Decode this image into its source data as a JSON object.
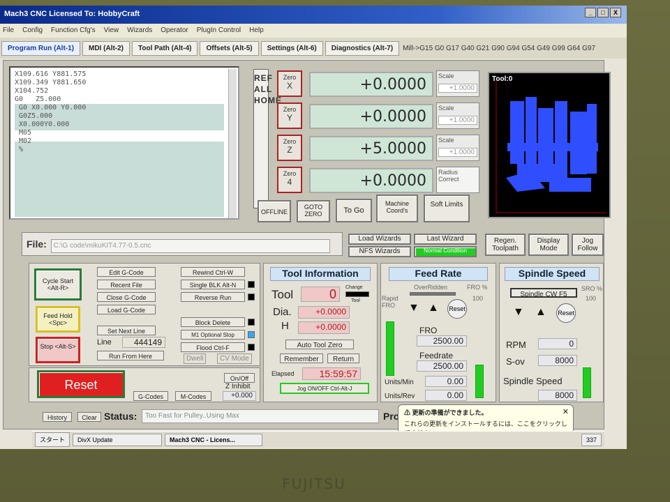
{
  "window": {
    "title": "Mach3 CNC   Licensed To: HobbyCraft",
    "buttons": [
      "_",
      "□",
      "X"
    ]
  },
  "menu": [
    "File",
    "Config",
    "Function Cfg's",
    "View",
    "Wizards",
    "Operator",
    "PlugIn Control",
    "Help"
  ],
  "tabs": [
    "Program Run (Alt-1)",
    "MDI (Alt-2)",
    "Tool Path (Alt-4)",
    "Offsets (Alt-5)",
    "Settings (Alt-6)",
    "Diagnostics (Alt-7)"
  ],
  "gcode_status": "Mill->G15  G0 G17 G40 G21 G90 G94 G54 G49 G99 G64 G97",
  "gcode_lines": [
    "X109.616 Y881.575",
    "X109.349 Y881.650",
    "X104.752",
    "G0   Z5.000",
    " G0 X0.000 Y0.000",
    " G0Z5.000",
    " X0.000Y0.000",
    " M05",
    " M02",
    " %"
  ],
  "refhome": "REF ALL HOME",
  "axes": [
    {
      "zero_label": "Zero",
      "axis": "X",
      "value": "+0.0000",
      "scale_label": "Scale",
      "scale": "+1.0000"
    },
    {
      "zero_label": "Zero",
      "axis": "Y",
      "value": "+0.0000",
      "scale_label": "Scale",
      "scale": "+1.0000"
    },
    {
      "zero_label": "Zero",
      "axis": "Z",
      "value": "+5.0000",
      "scale_label": "Scale",
      "scale": "+1.0000"
    },
    {
      "zero_label": "Zero",
      "axis": "4",
      "value": "+0.0000",
      "scale_label": "Radius Correct",
      "scale": ""
    }
  ],
  "dro_buttons": [
    "OFFLINE",
    "GOTO ZERO",
    "To Go",
    "Machine Coord's",
    "Soft Limits"
  ],
  "tool_view": {
    "label": "Tool:0"
  },
  "file": {
    "label": "File:",
    "path": "C:\\G code\\mikuKIT4.77-0.5.cnc"
  },
  "wizards": {
    "load": "Load Wizards",
    "last": "Last Wizard",
    "nfs": "NFS Wizards",
    "condition": "Normal Condition"
  },
  "view_buttons": [
    "Regen. Toolpath",
    "Display Mode",
    "Jog Follow"
  ],
  "run_panel": {
    "cycle_start": "Cycle Start <Alt-R>",
    "feed_hold": "Feed Hold <Spc>",
    "stop": "Stop <Alt-S>",
    "reset": "Reset",
    "edit": "Edit G-Code",
    "recent": "Recent File",
    "close": "Close G-Code",
    "load": "Load G-Code",
    "set_next": "Set Next Line",
    "line_label": "Line",
    "line_value": "444149",
    "run_from_here": "Run From Here",
    "rewind": "Rewind Ctrl-W",
    "single_blk": "Single BLK Alt-N",
    "reverse": "Reverse Run",
    "block_delete": "Block Delete",
    "m1_stop": "M1 Optional Stop",
    "flood": "Flood Ctrl-F",
    "dwell": "Dwell",
    "cv_mode": "CV Mode",
    "on_off": "On/Off",
    "z_inhibit": "Z Inhibit",
    "z_value": "+0.000",
    "gcodes": "G-Codes",
    "mcodes": "M-Codes"
  },
  "tool_info": {
    "title": "Tool Information",
    "tool_label": "Tool",
    "tool_value": "0",
    "change": "Change",
    "tool_small": "Tool",
    "dia_label": "Dia.",
    "dia_value": "+0.0000",
    "h_label": "H",
    "h_value": "+0.0000",
    "auto_zero": "Auto Tool Zero",
    "remember": "Remember",
    "return": "Return",
    "elapsed_label": "Elapsed",
    "elapsed": "15:59:57",
    "jog": "Jog ON/OFF Ctrl-Alt-J"
  },
  "feed": {
    "title": "Feed Rate",
    "overridden": "OverRidden",
    "fro_pct": "FRO %",
    "fro_pct_value": "100",
    "rapid": "Rapid FRO",
    "reset": "Reset",
    "fro_label": "FRO",
    "fro": "2500.00",
    "feedrate_label": "Feedrate",
    "feedrate": "2500.00",
    "units_min_label": "Units/Min",
    "units_min": "0.00",
    "units_rev_label": "Units/Rev",
    "units_rev": "0.00"
  },
  "spindle": {
    "title": "Spindle Speed",
    "cw": "Spindle CW F5",
    "sro": "SRO %",
    "sro_value": "100",
    "reset": "Reset",
    "rpm_label": "RPM",
    "rpm": "0",
    "sov_label": "S-ov",
    "sov": "8000",
    "speed_label": "Spindle Speed",
    "speed": "8000"
  },
  "status": {
    "history": "History",
    "clear": "Clear",
    "label": "Status:",
    "text": "Too Fast for Pulley..Using Max",
    "profile": "Pro"
  },
  "balloon": {
    "title": "更新の準備ができました。",
    "body": "これらの更新をインストールするには、ここをクリックしてください。"
  },
  "taskbar": {
    "start": "スタート",
    "items": [
      "DivX Update",
      "Mach3 CNC - Licens..."
    ],
    "clock": "337"
  },
  "monitor_brand": "FUJITSU"
}
